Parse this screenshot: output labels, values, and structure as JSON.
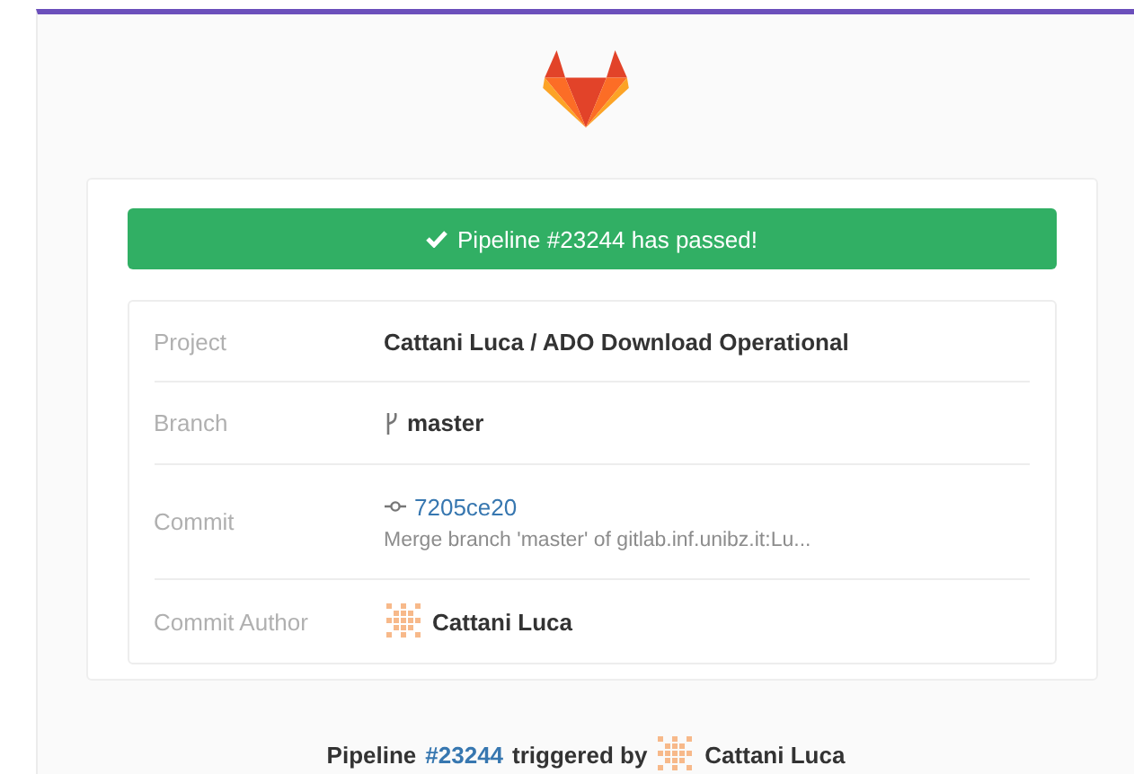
{
  "banner": {
    "passed": true,
    "text": "Pipeline #23244 has passed!"
  },
  "details": [
    {
      "kind": "project",
      "label": "Project",
      "value": "Cattani Luca / ADO Download Operational"
    },
    {
      "kind": "branch",
      "label": "Branch",
      "value": "master"
    },
    {
      "kind": "commit",
      "label": "Commit",
      "value": "7205ce20",
      "message": "Merge branch 'master' of gitlab.inf.unibz.it:Lu..."
    },
    {
      "kind": "author",
      "label": "Commit Author",
      "value": "Cattani Luca"
    }
  ],
  "footer": {
    "prefix": "Pipeline",
    "pipeline": "#23244",
    "middle": "triggered by",
    "author": "Cattani Luca"
  }
}
